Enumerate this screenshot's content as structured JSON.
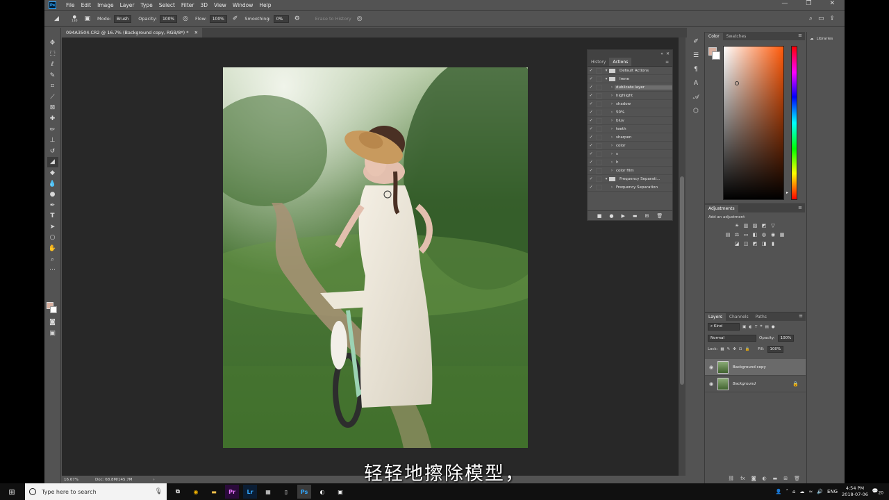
{
  "menubar": {
    "logo": "Ps",
    "items": [
      "File",
      "Edit",
      "Image",
      "Layer",
      "Type",
      "Select",
      "Filter",
      "3D",
      "View",
      "Window",
      "Help"
    ]
  },
  "options": {
    "brush_size": "130",
    "mode_label": "Mode:",
    "mode_value": "Brush",
    "opacity_label": "Opacity:",
    "opacity_value": "100%",
    "flow_label": "Flow:",
    "flow_value": "100%",
    "smoothing_label": "Smoothing:",
    "smoothing_value": "0%",
    "erase_history": "Erase to History"
  },
  "document": {
    "tab_title": "094A3504.CR2 @ 16.7% (Background copy, RGB/8*) *",
    "zoom": "16.67%",
    "doc_info": "Doc: 68.8M/145.7M"
  },
  "actions_panel": {
    "tabs": [
      "History",
      "Actions"
    ],
    "rows": [
      {
        "label": "Default Actions",
        "type": "set",
        "depth": 0
      },
      {
        "label": "Irene",
        "type": "set",
        "depth": 0
      },
      {
        "label": "dublicate layer",
        "type": "action",
        "depth": 1,
        "selected": true
      },
      {
        "label": "highlight",
        "type": "action",
        "depth": 1
      },
      {
        "label": "shadow",
        "type": "action",
        "depth": 1
      },
      {
        "label": "50%",
        "type": "action",
        "depth": 1
      },
      {
        "label": "bluv",
        "type": "action",
        "depth": 1
      },
      {
        "label": "teeth",
        "type": "action",
        "depth": 1
      },
      {
        "label": "sharpen",
        "type": "action",
        "depth": 1
      },
      {
        "label": "color",
        "type": "action",
        "depth": 1
      },
      {
        "label": "s",
        "type": "action",
        "depth": 1
      },
      {
        "label": "h",
        "type": "action",
        "depth": 1
      },
      {
        "label": "color film",
        "type": "action",
        "depth": 1
      },
      {
        "label": "Frequency Separati...",
        "type": "set",
        "depth": 0
      },
      {
        "label": "Frequency Separation",
        "type": "action",
        "depth": 1
      }
    ]
  },
  "color_panel": {
    "tabs": [
      "Color",
      "Swatches"
    ],
    "foreground": "#d8b0a0",
    "background": "#ffffff"
  },
  "adjustments_panel": {
    "title": "Adjustments",
    "add_label": "Add an adjustment"
  },
  "layers_panel": {
    "tabs": [
      "Layers",
      "Channels",
      "Paths"
    ],
    "kind_label": "Kind",
    "blend_mode": "Normal",
    "opacity_label": "Opacity:",
    "opacity_value": "100%",
    "lock_label": "Lock:",
    "fill_label": "Fill:",
    "fill_value": "100%",
    "layers": [
      {
        "name": "Background copy",
        "selected": true,
        "locked": false
      },
      {
        "name": "Background",
        "selected": false,
        "locked": true
      }
    ]
  },
  "libraries_label": "Libraries",
  "subtitle": "轻轻地擦除模型，",
  "taskbar": {
    "search_placeholder": "Type here to search",
    "language": "ENG",
    "time": "4:54 PM",
    "date": "2018-07-06",
    "notification_count": "20"
  }
}
